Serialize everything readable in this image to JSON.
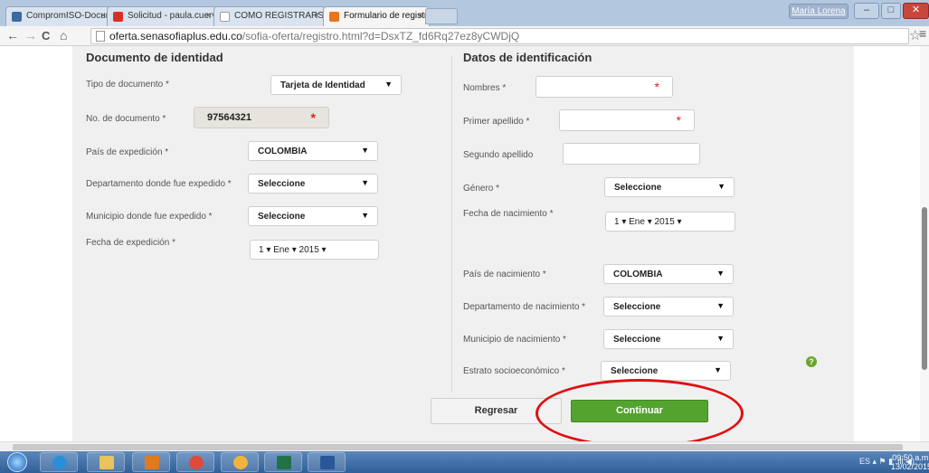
{
  "browser": {
    "tabs": [
      {
        "title": "CompromISO-Document",
        "favicon_color": "#3b6aa0"
      },
      {
        "title": "Solicitud - paula.cuervo@",
        "favicon_color": "#d93025"
      },
      {
        "title": "COMO REGISTRARSE EN S",
        "favicon_color": "#9aa0a6"
      },
      {
        "title": "Formulario de registro par",
        "favicon_color": "#e8761a"
      }
    ],
    "close_glyph": "×",
    "user_label": "María Lorena",
    "window_buttons": [
      "–",
      "□",
      "✕"
    ],
    "nav": {
      "back": "←",
      "forward": "→",
      "reload": "C",
      "home": "⌂"
    },
    "url_host": "oferta.senasofiaplus.edu.co",
    "url_rest": "/sofia-oferta/registro.html?d=DsxTZ_fd6Rq27ez8yCWDjQ",
    "star": "☆",
    "menu": "≡"
  },
  "form": {
    "identity": {
      "title": "Documento de identidad",
      "tipo_label": "Tipo de documento *",
      "tipo_value": "Tarjeta de Identidad",
      "numero_label": "No. de documento *",
      "numero_value": "97564321",
      "pais_label": "País de expedición *",
      "pais_value": "COLOMBIA",
      "depto_label": "Departamento donde fue expedido *",
      "depto_value": "Seleccione",
      "municipio_label": "Municipio donde fue expedido *",
      "municipio_value": "Seleccione",
      "fecha_label": "Fecha de expedición *",
      "fecha_value": "1  ▾  Ene  ▾  2015  ▾"
    },
    "personal": {
      "title": "Datos de identificación",
      "nombres_label": "Nombres *",
      "primer_label": "Primer apellido *",
      "segundo_label": "Segundo apellido",
      "genero_label": "Género *",
      "genero_value": "Seleccione",
      "nacimiento_label": "Fecha de nacimiento *",
      "nacimiento_value": "1  ▾  Ene  ▾  2015  ▾",
      "pais_label": "País de nacimiento *",
      "pais_value": "COLOMBIA",
      "depto_label": "Departamento de nacimiento *",
      "depto_value": "Seleccione",
      "municipio_label": "Municipio de nacimiento *",
      "municipio_value": "Seleccione",
      "estrato_label": "Estrato socioeconómico *",
      "estrato_value": "Seleccione"
    },
    "required_mark": "*",
    "caret": "▼",
    "help_glyph": "?",
    "back_label": "Regresar",
    "continue_label": "Continuar"
  },
  "taskbar": {
    "tray_text": "ES  ▴  ⚑  ▮  .ıll  ◀)",
    "time": "09:50 a.m.",
    "date": "13/02/2015",
    "apps": [
      {
        "name": "internet-explorer",
        "color": "#2a8fd8"
      },
      {
        "name": "file-explorer",
        "color": "#e8c45a"
      },
      {
        "name": "media-player",
        "color": "#e07a1f"
      },
      {
        "name": "chrome",
        "color": "#dd4b39"
      },
      {
        "name": "messenger",
        "color": "#f0b43c"
      },
      {
        "name": "excel",
        "color": "#217346"
      },
      {
        "name": "word",
        "color": "#2b579a"
      }
    ]
  }
}
